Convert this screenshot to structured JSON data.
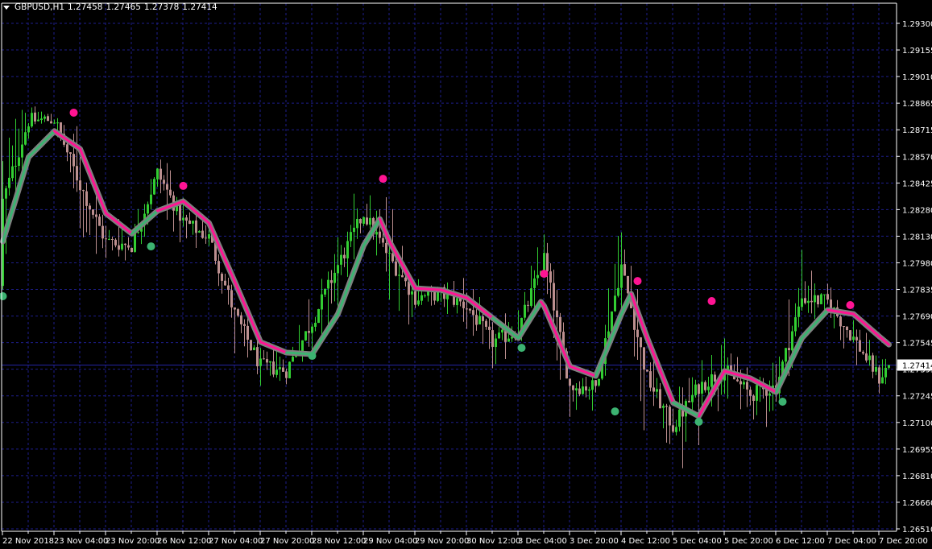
{
  "header": {
    "symbol_tf": "GBPUSD,H1",
    "open": "1.27458",
    "high": "1.27465",
    "low": "1.27378",
    "close": "1.27414"
  },
  "chart_data": {
    "type": "candlestick",
    "ylim": [
      1.2651,
      1.293
    ],
    "grid": true,
    "current_price": "1.27414",
    "y_ticks": [
      "1.29300",
      "1.29155",
      "1.29010",
      "1.28865",
      "1.28715",
      "1.28570",
      "1.28425",
      "1.28280",
      "1.28130",
      "1.27980",
      "1.27835",
      "1.27690",
      "1.27545",
      "1.27395",
      "1.27245",
      "1.27100",
      "1.26955",
      "1.26810",
      "1.26660",
      "1.26510"
    ],
    "x_ticks": [
      "22 Nov 2018",
      "23 Nov 04:00",
      "23 Nov 20:00",
      "26 Nov 12:00",
      "27 Nov 04:00",
      "27 Nov 20:00",
      "28 Nov 12:00",
      "29 Nov 04:00",
      "29 Nov 20:00",
      "30 Nov 12:00",
      "3 Dec 04:00",
      "3 Dec 20:00",
      "4 Dec 12:00",
      "5 Dec 04:00",
      "5 Dec 20:00",
      "6 Dec 12:00",
      "7 Dec 04:00",
      "7 Dec 20:00"
    ],
    "price_path": [
      {
        "t": "22 Nov 12:00",
        "close": 1.28318,
        "high": 1.28851,
        "low": 1.27852
      },
      {
        "t": "22 Nov 20:00",
        "close": 1.28762,
        "high": 1.2886,
        "low": 1.28562
      },
      {
        "t": "23 Nov 04:00",
        "close": 1.28771,
        "high": 1.28851,
        "low": 1.28718
      },
      {
        "t": "23 Nov 12:00",
        "close": 1.28407,
        "high": 1.28718,
        "low": 1.28096
      },
      {
        "t": "23 Nov 20:00",
        "close": 1.28096,
        "high": 1.28274,
        "low": 1.27985
      },
      {
        "t": "26 Nov 04:00",
        "close": 1.28074,
        "high": 1.28185,
        "low": 1.27963
      },
      {
        "t": "26 Nov 12:00",
        "close": 1.28474,
        "high": 1.28629,
        "low": 1.28274
      },
      {
        "t": "26 Nov 20:00",
        "close": 1.28207,
        "high": 1.28407,
        "low": 1.28052
      },
      {
        "t": "27 Nov 04:00",
        "close": 1.28118,
        "high": 1.28207,
        "low": 1.28052
      },
      {
        "t": "27 Nov 12:00",
        "close": 1.27696,
        "high": 1.27874,
        "low": 1.27474
      },
      {
        "t": "27 Nov 20:00",
        "close": 1.27407,
        "high": 1.27563,
        "low": 1.27252
      },
      {
        "t": "28 Nov 04:00",
        "close": 1.27385,
        "high": 1.27474,
        "low": 1.27296
      },
      {
        "t": "28 Nov 12:00",
        "close": 1.27652,
        "high": 1.27918,
        "low": 1.27429
      },
      {
        "t": "28 Nov 20:00",
        "close": 1.27963,
        "high": 1.28451,
        "low": 1.27652
      },
      {
        "t": "29 Nov 04:00",
        "close": 1.28251,
        "high": 1.28362,
        "low": 1.28185
      },
      {
        "t": "29 Nov 12:00",
        "close": 1.28007,
        "high": 1.28362,
        "low": 1.27563
      },
      {
        "t": "29 Nov 20:00",
        "close": 1.27785,
        "high": 1.27918,
        "low": 1.27652
      },
      {
        "t": "30 Nov 04:00",
        "close": 1.27807,
        "high": 1.27874,
        "low": 1.2774
      },
      {
        "t": "30 Nov 12:00",
        "close": 1.2774,
        "high": 1.27918,
        "low": 1.27563
      },
      {
        "t": "30 Nov 20:00",
        "close": 1.27541,
        "high": 1.27696,
        "low": 1.27385
      },
      {
        "t": "3 Dec 04:00",
        "close": 1.27607,
        "high": 1.2774,
        "low": 1.27474
      },
      {
        "t": "3 Dec 12:00",
        "close": 1.28007,
        "high": 1.28229,
        "low": 1.27652
      },
      {
        "t": "3 Dec 20:00",
        "close": 1.27296,
        "high": 1.27474,
        "low": 1.2703
      },
      {
        "t": "4 Dec 04:00",
        "close": 1.27296,
        "high": 1.27429,
        "low": 1.27163
      },
      {
        "t": "4 Dec 12:00",
        "close": 1.27963,
        "high": 1.28362,
        "low": 1.27563
      },
      {
        "t": "4 Dec 20:00",
        "close": 1.27341,
        "high": 1.27652,
        "low": 1.26763
      },
      {
        "t": "5 Dec 04:00",
        "close": 1.27074,
        "high": 1.27207,
        "low": 1.26852
      },
      {
        "t": "5 Dec 12:00",
        "close": 1.27296,
        "high": 1.27652,
        "low": 1.26763
      },
      {
        "t": "5 Dec 20:00",
        "close": 1.27385,
        "high": 1.27563,
        "low": 1.27207
      },
      {
        "t": "6 Dec 04:00",
        "close": 1.27252,
        "high": 1.27385,
        "low": 1.27118
      },
      {
        "t": "6 Dec 12:00",
        "close": 1.27296,
        "high": 1.27563,
        "low": 1.2703
      },
      {
        "t": "6 Dec 20:00",
        "close": 1.27785,
        "high": 1.28096,
        "low": 1.27563
      },
      {
        "t": "7 Dec 04:00",
        "close": 1.27763,
        "high": 1.27874,
        "low": 1.27652
      },
      {
        "t": "7 Dec 12:00",
        "close": 1.27563,
        "high": 1.2774,
        "low": 1.27385
      },
      {
        "t": "7 Dec 20:00",
        "close": 1.27341,
        "high": 1.27474,
        "low": 1.27207
      },
      {
        "t": "7 Dec 23:00",
        "close": 1.27414,
        "high": 1.27474,
        "low": 1.27341
      }
    ],
    "trend_line": [
      {
        "t": "22 Nov 12:00",
        "value": 1.28096,
        "trend": "up"
      },
      {
        "t": "22 Nov 20:00",
        "value": 1.28562,
        "trend": "up"
      },
      {
        "t": "23 Nov 04:00",
        "value": 1.28705,
        "trend": "up"
      },
      {
        "t": "23 Nov 12:00",
        "value": 1.28607,
        "trend": "down"
      },
      {
        "t": "23 Nov 20:00",
        "value": 1.28251,
        "trend": "down"
      },
      {
        "t": "26 Nov 04:00",
        "value": 1.2814,
        "trend": "down"
      },
      {
        "t": "26 Nov 12:00",
        "value": 1.28265,
        "trend": "up"
      },
      {
        "t": "26 Nov 20:00",
        "value": 1.28318,
        "trend": "down"
      },
      {
        "t": "27 Nov 04:00",
        "value": 1.28198,
        "trend": "down"
      },
      {
        "t": "27 Nov 12:00",
        "value": 1.27874,
        "trend": "down"
      },
      {
        "t": "27 Nov 20:00",
        "value": 1.27541,
        "trend": "down"
      },
      {
        "t": "28 Nov 04:00",
        "value": 1.27483,
        "trend": "down"
      },
      {
        "t": "28 Nov 12:00",
        "value": 1.27474,
        "trend": "up"
      },
      {
        "t": "28 Nov 20:00",
        "value": 1.27696,
        "trend": "up"
      },
      {
        "t": "29 Nov 04:00",
        "value": 1.28074,
        "trend": "up"
      },
      {
        "t": "29 Nov 09:00",
        "value": 1.2822,
        "trend": "up"
      },
      {
        "t": "29 Nov 12:00",
        "value": 1.28096,
        "trend": "down"
      },
      {
        "t": "29 Nov 20:00",
        "value": 1.27838,
        "trend": "down"
      },
      {
        "t": "30 Nov 04:00",
        "value": 1.27829,
        "trend": "down"
      },
      {
        "t": "30 Nov 12:00",
        "value": 1.27785,
        "trend": "down"
      },
      {
        "t": "30 Nov 20:00",
        "value": 1.27674,
        "trend": "down"
      },
      {
        "t": "3 Dec 04:00",
        "value": 1.27563,
        "trend": "up"
      },
      {
        "t": "3 Dec 11:00",
        "value": 1.27763,
        "trend": "up"
      },
      {
        "t": "3 Dec 12:00",
        "value": 1.2774,
        "trend": "down"
      },
      {
        "t": "3 Dec 20:00",
        "value": 1.27407,
        "trend": "down"
      },
      {
        "t": "4 Dec 04:00",
        "value": 1.27354,
        "trend": "down"
      },
      {
        "t": "4 Dec 12:00",
        "value": 1.27696,
        "trend": "up"
      },
      {
        "t": "4 Dec 15:00",
        "value": 1.27807,
        "trend": "up"
      },
      {
        "t": "4 Dec 20:00",
        "value": 1.27563,
        "trend": "down"
      },
      {
        "t": "5 Dec 04:00",
        "value": 1.27207,
        "trend": "down"
      },
      {
        "t": "5 Dec 12:00",
        "value": 1.27132,
        "trend": "up"
      },
      {
        "t": "5 Dec 20:00",
        "value": 1.27381,
        "trend": "down"
      },
      {
        "t": "6 Dec 04:00",
        "value": 1.27341,
        "trend": "down"
      },
      {
        "t": "6 Dec 12:00",
        "value": 1.27265,
        "trend": "down"
      },
      {
        "t": "6 Dec 20:00",
        "value": 1.27563,
        "trend": "up"
      },
      {
        "t": "7 Dec 04:00",
        "value": 1.27718,
        "trend": "up"
      },
      {
        "t": "7 Dec 12:00",
        "value": 1.27696,
        "trend": "down"
      },
      {
        "t": "7 Dec 20:00",
        "value": 1.27572,
        "trend": "down"
      },
      {
        "t": "7 Dec 23:00",
        "value": 1.27527,
        "trend": "down"
      }
    ],
    "signals": [
      {
        "t": "23 Nov 10:00",
        "price": 1.28807,
        "type": "sell"
      },
      {
        "t": "26 Nov 20:00",
        "price": 1.28403,
        "type": "sell"
      },
      {
        "t": "29 Nov 10:00",
        "price": 1.28442,
        "type": "sell"
      },
      {
        "t": "3 Dec 12:00",
        "price": 1.27918,
        "type": "sell"
      },
      {
        "t": "4 Dec 17:00",
        "price": 1.27878,
        "type": "sell"
      },
      {
        "t": "5 Dec 16:00",
        "price": 1.27767,
        "type": "sell"
      },
      {
        "t": "7 Dec 11:00",
        "price": 1.27745,
        "type": "sell"
      },
      {
        "t": "22 Nov 12:00",
        "price": 1.27794,
        "type": "buy"
      },
      {
        "t": "26 Nov 10:00",
        "price": 1.28069,
        "type": "buy"
      },
      {
        "t": "28 Nov 12:00",
        "price": 1.27465,
        "type": "buy"
      },
      {
        "t": "3 Dec 05:00",
        "price": 1.27509,
        "type": "buy"
      },
      {
        "t": "4 Dec 10:00",
        "price": 1.27158,
        "type": "buy"
      },
      {
        "t": "5 Dec 12:00",
        "price": 1.27101,
        "type": "buy"
      },
      {
        "t": "6 Dec 14:00",
        "price": 1.27212,
        "type": "buy"
      }
    ],
    "colors": {
      "background": "#000000",
      "grid": "#1e1e8c",
      "bull_candle": "#32cd32",
      "bear_candle": "#bc8f8f",
      "trend_outline": "#7f7f7f",
      "trend_up": "#3cb371",
      "trend_down": "#ff1493",
      "signal_buy": "#3cb371",
      "signal_sell": "#ff1493",
      "current_price_line": "#2323a0",
      "axis": "#ffffff"
    }
  }
}
